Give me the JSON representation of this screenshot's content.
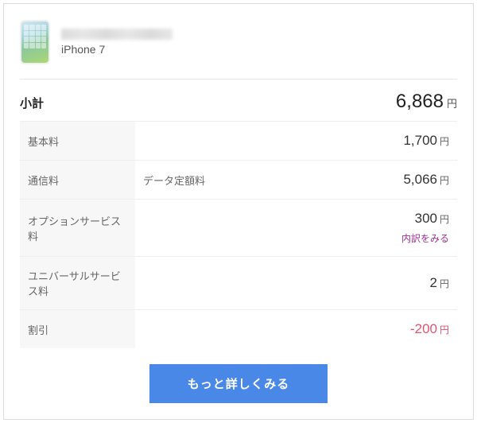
{
  "product": {
    "name": "iPhone 7"
  },
  "subtotal": {
    "label": "小計",
    "amount": "6,868",
    "unit": "円"
  },
  "rows": [
    {
      "label": "基本料",
      "middle": "",
      "amount": "1,700",
      "unit": "円",
      "breakdown": "",
      "negative": false
    },
    {
      "label": "通信料",
      "middle": "データ定額料",
      "amount": "5,066",
      "unit": "円",
      "breakdown": "",
      "negative": false
    },
    {
      "label": "オプションサービス料",
      "middle": "",
      "amount": "300",
      "unit": "円",
      "breakdown": "内訳をみる",
      "negative": false
    },
    {
      "label": "ユニバーサルサービス料",
      "middle": "",
      "amount": "2",
      "unit": "円",
      "breakdown": "",
      "negative": false
    },
    {
      "label": "割引",
      "middle": "",
      "amount": "-200",
      "unit": "円",
      "breakdown": "",
      "negative": true
    }
  ],
  "button": {
    "label": "もっと詳しくみる"
  }
}
